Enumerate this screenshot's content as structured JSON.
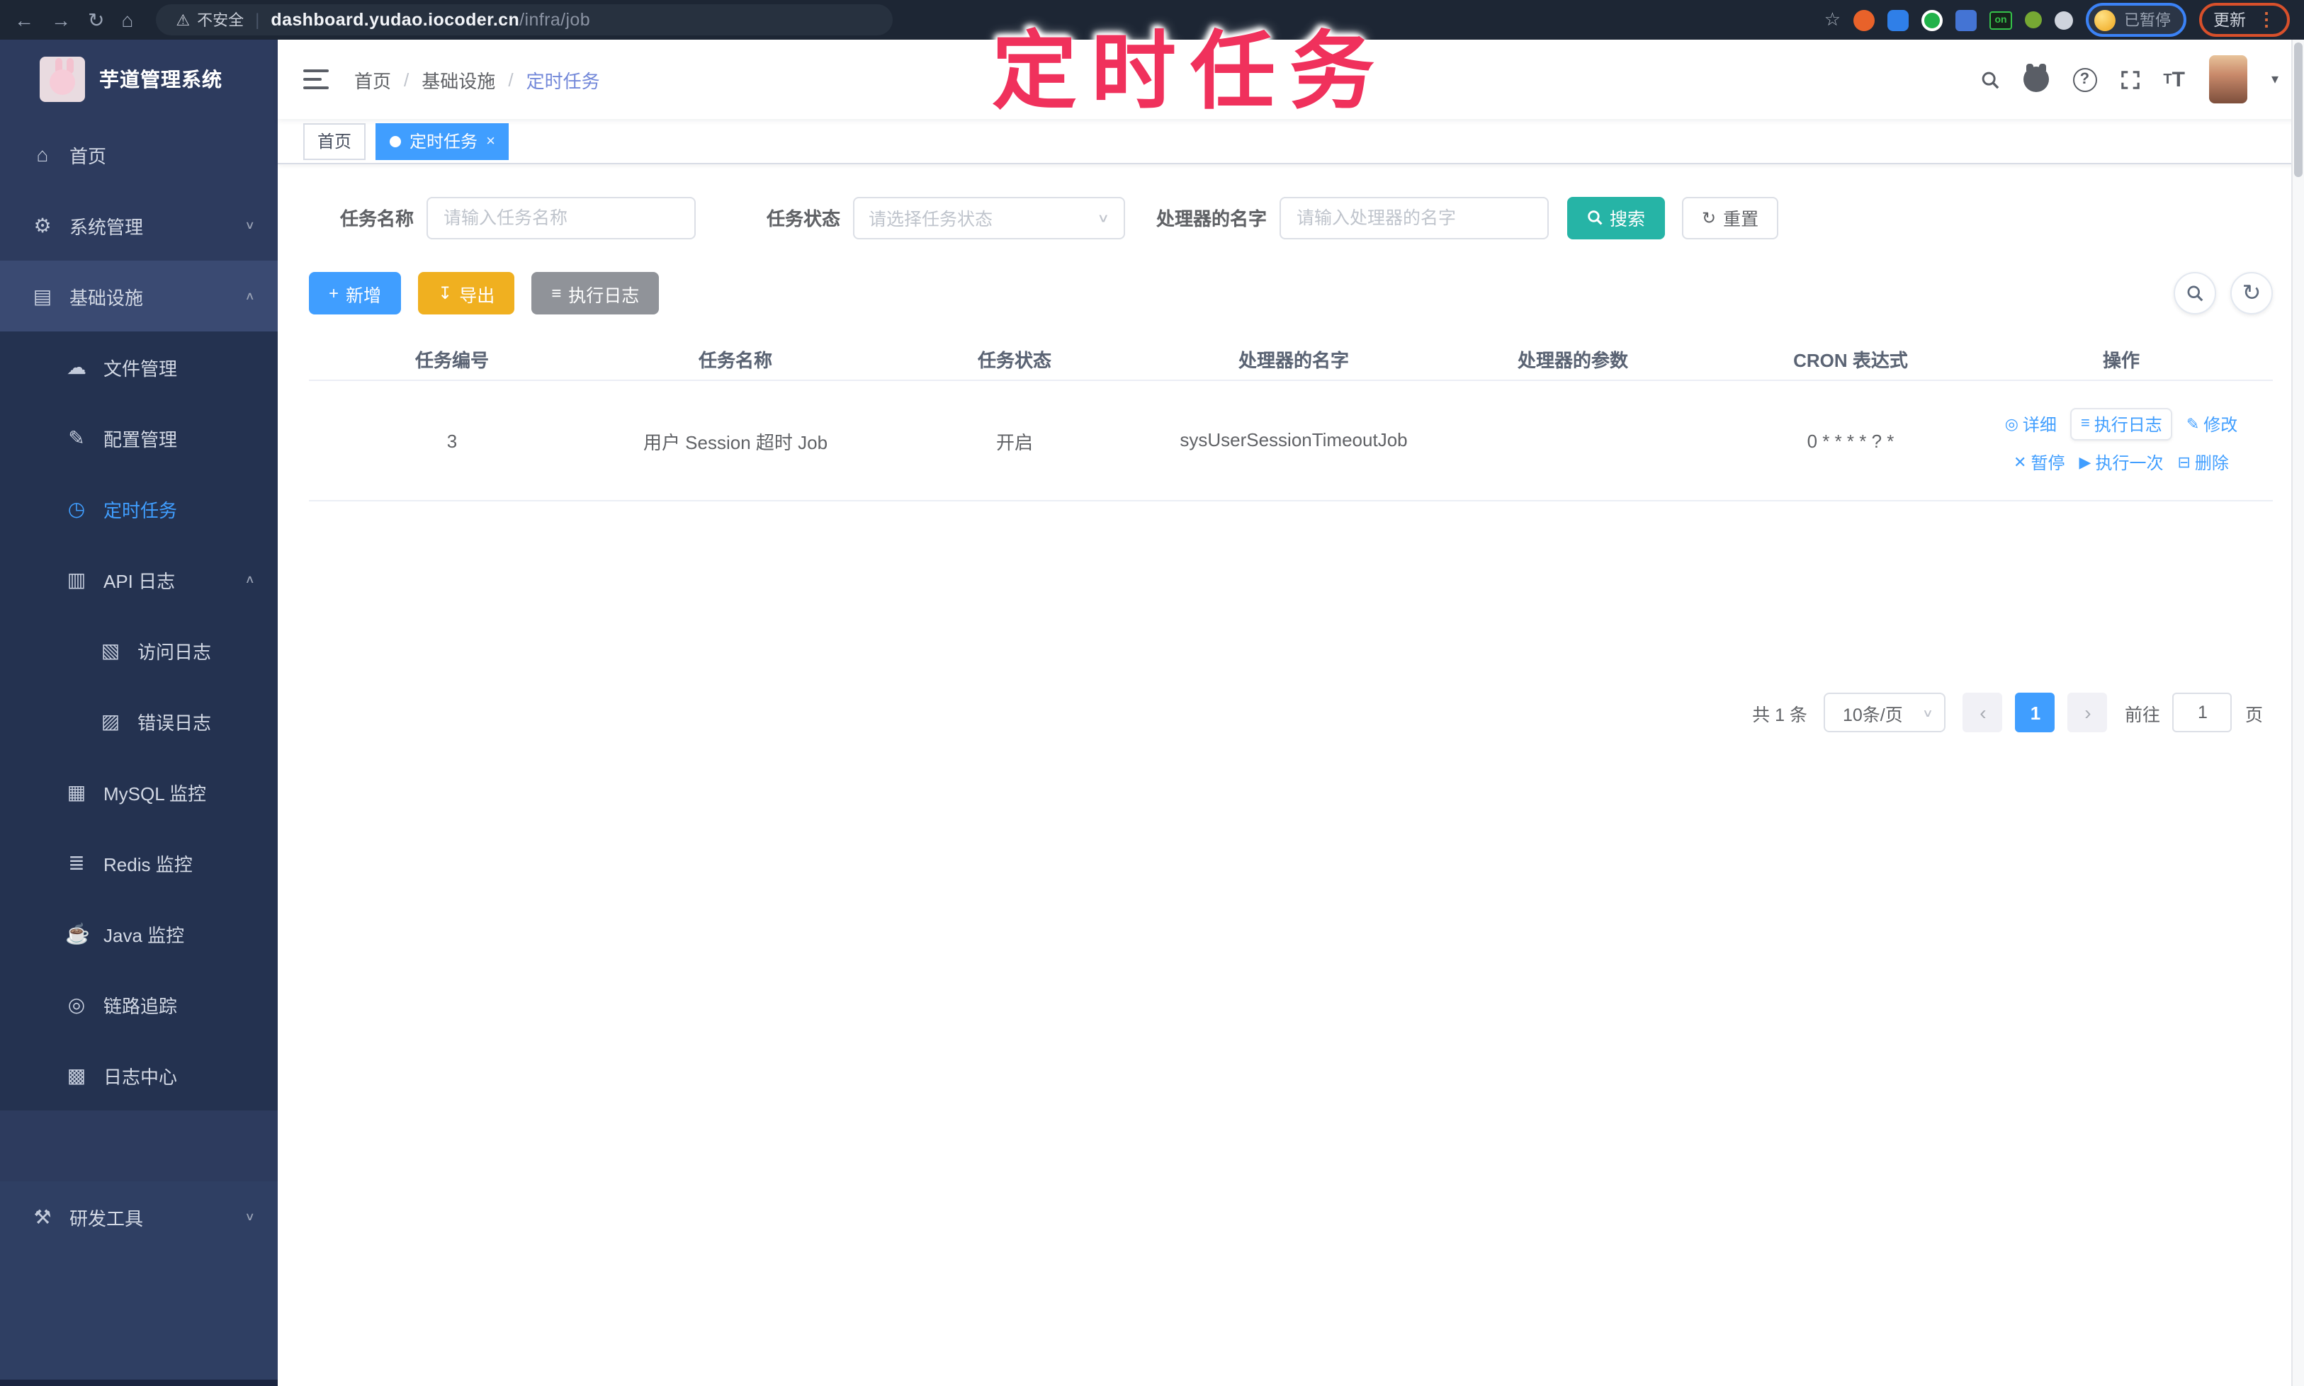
{
  "browser": {
    "security_label": "不安全",
    "url_host": "dashboard.yudao.iocoder.cn",
    "url_path": "/infra/job",
    "profile_status": "已暂停",
    "update_label": "更新"
  },
  "annotation": {
    "text": "定时任务",
    "color": "#f0315c"
  },
  "sidebar": {
    "title": "芋道管理系统",
    "items": [
      {
        "label": "首页",
        "icon": "⌂"
      },
      {
        "label": "系统管理",
        "icon": "⚙",
        "chevron": "∨"
      },
      {
        "label": "基础设施",
        "icon": "▤",
        "chevron": "∧"
      },
      {
        "label": "文件管理",
        "icon": "☁"
      },
      {
        "label": "配置管理",
        "icon": "✎"
      },
      {
        "label": "定时任务",
        "icon": "◷"
      },
      {
        "label": "API 日志",
        "icon": "▥",
        "chevron": "∧"
      },
      {
        "label": "访问日志",
        "icon": "▧"
      },
      {
        "label": "错误日志",
        "icon": "▨"
      },
      {
        "label": "MySQL 监控",
        "icon": "▦"
      },
      {
        "label": "Redis 监控",
        "icon": "≣"
      },
      {
        "label": "Java 监控",
        "icon": "☕"
      },
      {
        "label": "链路追踪",
        "icon": "◎"
      },
      {
        "label": "日志中心",
        "icon": "▩"
      },
      {
        "label": "研发工具",
        "icon": "⚒",
        "chevron": "∨"
      }
    ]
  },
  "navbar": {
    "breadcrumb": [
      "首页",
      "基础设施",
      "定时任务"
    ],
    "separator": "/"
  },
  "tabs": [
    {
      "label": "首页"
    },
    {
      "label": "定时任务",
      "close": "×"
    }
  ],
  "filters": {
    "name_label": "任务名称",
    "name_placeholder": "请输入任务名称",
    "status_label": "任务状态",
    "status_placeholder": "请选择任务状态",
    "handler_label": "处理器的名字",
    "handler_placeholder": "请输入处理器的名字",
    "search_label": "搜索",
    "reset_label": "重置",
    "reset_icon": "↻"
  },
  "toolbar": {
    "add_label": "新增",
    "add_icon": "+",
    "export_label": "导出",
    "export_icon": "↧",
    "exec_log_label": "执行日志",
    "exec_log_icon": "≡",
    "refresh_icon": "↻"
  },
  "table": {
    "columns": [
      "任务编号",
      "任务名称",
      "任务状态",
      "处理器的名字",
      "处理器的参数",
      "CRON 表达式",
      "操作"
    ],
    "row": {
      "id": "3",
      "name": "用户 Session 超时 Job",
      "status": "开启",
      "handler": "sysUserSessionTimeoutJob",
      "param": "",
      "cron": "0 * * * * ? *"
    },
    "actions": {
      "detail": "详细",
      "detail_icon": "◎",
      "exec_log": "执行日志",
      "exec_log_icon": "≡",
      "modify": "修改",
      "modify_icon": "✎",
      "pause": "暂停",
      "pause_icon": "✕",
      "run_once": "执行一次",
      "run_once_icon": "▶",
      "delete": "删除",
      "delete_icon": "⊟"
    }
  },
  "pagination": {
    "total_label": "共 1 条",
    "page_size": "10条/页",
    "prev": "‹",
    "current_page": "1",
    "next": "›",
    "goto_label": "前往",
    "goto_value": "1",
    "page_unit": "页"
  },
  "colors": {
    "accent": "#409eff",
    "search_teal": "#26b4a6",
    "export_yellow": "#f0b020",
    "sidebar_bg": "#2d3b5e"
  }
}
